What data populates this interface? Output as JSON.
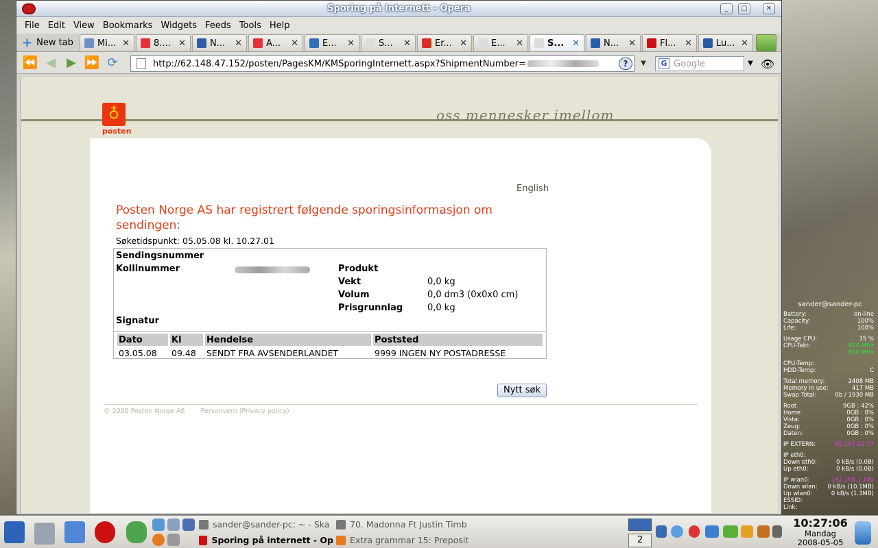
{
  "window": {
    "title": "Sporing på internett - Opera"
  },
  "menu": [
    "File",
    "Edit",
    "View",
    "Bookmarks",
    "Widgets",
    "Feeds",
    "Tools",
    "Help"
  ],
  "newtab_label": "New tab",
  "tabs": [
    {
      "label": "Mi...",
      "icon_color": "#6d8fc8",
      "active": false
    },
    {
      "label": "8....",
      "icon_color": "#e53238",
      "active": false
    },
    {
      "label": "N...",
      "icon_color": "#2c5ea8",
      "active": false
    },
    {
      "label": "A...",
      "icon_color": "#e53238",
      "active": false
    },
    {
      "label": "E...",
      "icon_color": "#2f6fb8",
      "active": false
    },
    {
      "label": "S...",
      "icon_color": "#dddddd",
      "active": false
    },
    {
      "label": "Er...",
      "icon_color": "#d93025",
      "active": false
    },
    {
      "label": "E...",
      "icon_color": "#dddddd",
      "active": false
    },
    {
      "label": "S...",
      "icon_color": "#dddddd",
      "active": true
    },
    {
      "label": "N...",
      "icon_color": "#2c5ea8",
      "active": false
    },
    {
      "label": "Fl...",
      "icon_color": "#cc0f16",
      "active": false
    },
    {
      "label": "Lu...",
      "icon_color": "#2d5ba3",
      "active": false
    }
  ],
  "address": {
    "url": "http://62.148.47.152/posten/PagesKM/KMSporingInternett.aspx?ShipmentNumber="
  },
  "search": {
    "placeholder": "Google"
  },
  "page": {
    "slogan": "oss mennesker imellom",
    "logo_text": "posten",
    "english": "English",
    "headline": "Posten Norge AS har registrert følgende sporingsinformasjon om sendingen:",
    "search_time": "Søketidspunkt: 05.05.08 kl. 10.27.01",
    "labels": {
      "sendingsnummer": "Sendingsnummer",
      "kollinummer": "Kollinummer",
      "produkt": "Produkt",
      "vekt": "Vekt",
      "volum": "Volum",
      "prisgrunnlag": "Prisgrunnlag",
      "signatur": "Signatur"
    },
    "values": {
      "vekt": "0,0 kg",
      "volum": "0,0 dm3 (0x0x0 cm)",
      "prisgrunnlag": "0,0 kg"
    },
    "events_headers": [
      "Dato",
      "Kl",
      "Hendelse",
      "Poststed"
    ],
    "events": [
      [
        "03.05.08",
        "09.48",
        "SENDT FRA AVSENDERLANDET",
        "9999 INGEN NY POSTADRESSE"
      ]
    ],
    "new_search": "Nytt søk",
    "footer": [
      "© 2008 Posten Norge AS",
      "Personvern (Privacy policy)"
    ]
  },
  "sysmon": {
    "user": "sander@sander-pc",
    "rows1": [
      [
        "Battery:",
        "on-line"
      ],
      [
        "Capacity:",
        "100%"
      ],
      [
        "Life:",
        "100%"
      ]
    ],
    "rows2": [
      [
        "Usage CPU:",
        "35 %"
      ],
      [
        "CPU-Takt:",
        "800 MHz"
      ],
      [
        "",
        "800 MHz"
      ]
    ],
    "rows3": [
      [
        "CPU-Temp:",
        ""
      ],
      [
        "HDD-Temp:",
        "C"
      ]
    ],
    "rows4": [
      [
        "Total memory:",
        "2408 MB"
      ],
      [
        "Memory in use:",
        "417 MB"
      ],
      [
        "Swap Total:",
        "0b / 1930 MB"
      ]
    ],
    "rows5": [
      [
        "Root",
        "9GB : 42%"
      ],
      [
        "Home",
        "0GB : 0%"
      ],
      [
        "Vista:",
        "0GB : 0%"
      ],
      [
        "Zeug:",
        "0GB : 0%"
      ],
      [
        "Daten:",
        "0GB : 0%"
      ]
    ],
    "rows6": [
      [
        "IP EXTERN:",
        "85.167.52.77"
      ]
    ],
    "rows7": [
      [
        "IP eth0:",
        ""
      ],
      [
        "Down eth0:",
        "0 kB/s   (0.0B)"
      ],
      [
        "Up eth0:",
        "0 kB/s   (0.0B)"
      ]
    ],
    "rows8": [
      [
        "IP wlan0:",
        "192.168.1.100"
      ],
      [
        "Down wlan:",
        "0 kB/s  (10.1MB)"
      ],
      [
        "Up wlan0:",
        "0 kB/s   (1.3MB)"
      ],
      [
        "ESSID:",
        ""
      ],
      [
        "Link:",
        ""
      ]
    ]
  },
  "taskbar": {
    "tasks": [
      "sander@sander-pc: ~ - Ska",
      "70. Madonna Ft Justin Timb",
      "Sporing på internett - Op",
      "Extra grammar 15: Preposit"
    ],
    "desktop_num": "2",
    "time": "10:27:06",
    "day": "Mandag",
    "date": "2008-05-05"
  }
}
